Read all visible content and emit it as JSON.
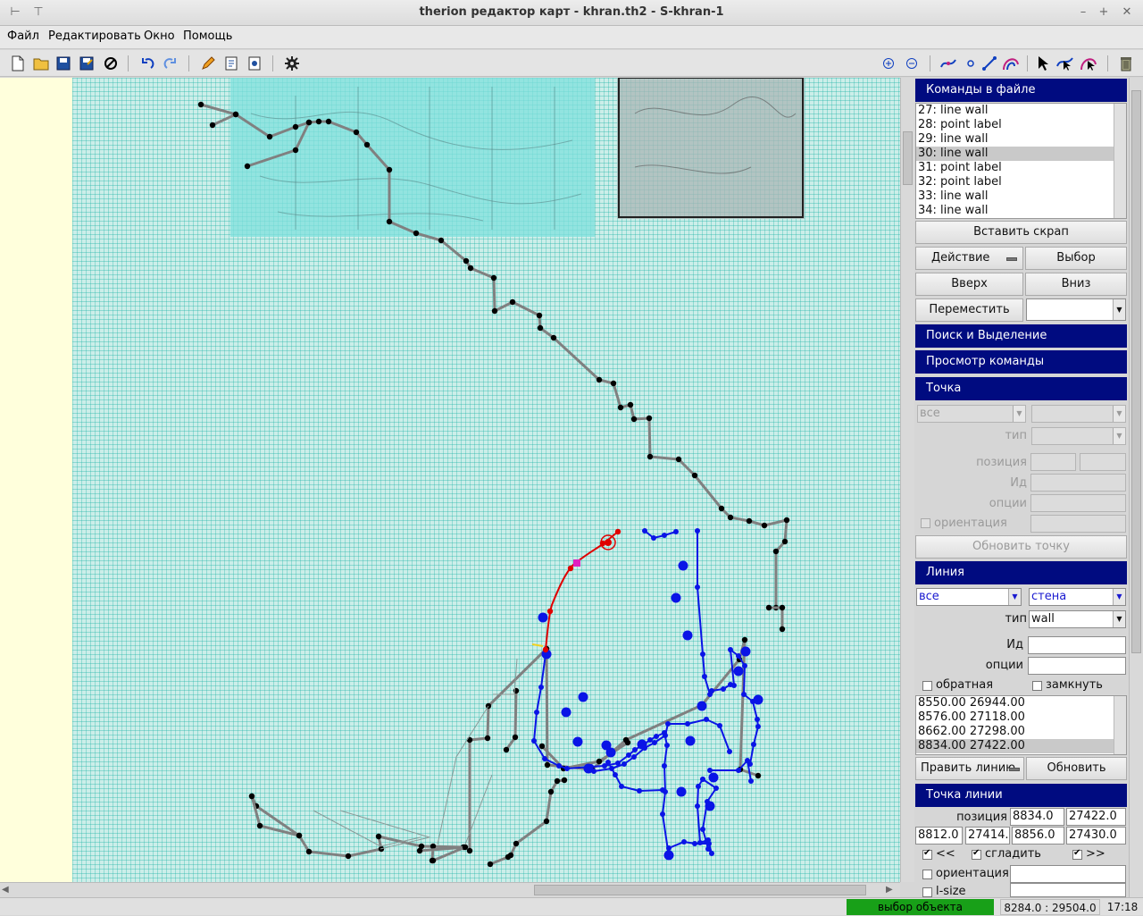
{
  "window": {
    "title": "therion редактор карт - khran.th2 - S-khran-1"
  },
  "menu": {
    "file": "Файл",
    "edit": "Редактировать",
    "window": "Окно",
    "help": "Помощь"
  },
  "toolbar": {
    "left_icons": [
      "new-file-icon",
      "open-folder-icon",
      "save-icon",
      "save-as-icon",
      "close-icon",
      "undo-icon",
      "redo-icon",
      "edit-pencil-icon",
      "page-properties-icon",
      "settings-gear-icon",
      "compile-gear-icon"
    ],
    "right_icons": [
      "zoom-in-icon",
      "zoom-out-icon",
      "insert-line-icon",
      "insert-point-icon",
      "insert-segment-icon",
      "insert-area-icon",
      "select-pointer-icon",
      "select-line-icon",
      "edit-area-icon",
      "trash-icon"
    ]
  },
  "panel": {
    "commands_header": "Команды в файле",
    "commands": [
      "27: line wall",
      "28: point label",
      "29: line wall",
      "30: line wall",
      "31: point label",
      "32: point label",
      "33: line wall",
      "34: line wall"
    ],
    "commands_selected": 3,
    "insert_scrap_button": "Вставить скрап",
    "action_button": "Действие",
    "select_button": "Выбор",
    "up_button": "Вверх",
    "down_button": "Вниз",
    "move_button": "Переместить",
    "move_target": "",
    "search_header": "Поиск и Выделение",
    "view_cmd_header": "Просмотр команды",
    "point_header": "Точка",
    "point_filter": "все",
    "point_filter2": "",
    "point_type_label": "тип",
    "point_type": "",
    "point_position_label": "позиция",
    "point_position_x": "",
    "point_position_y": "",
    "point_id_label": "Ид",
    "point_id": "",
    "point_options_label": "опции",
    "point_options": "",
    "point_orient_label": "ориентация",
    "point_orient": "",
    "update_point_button": "Обновить точку",
    "line_header": "Линия",
    "line_filter": "все",
    "line_class": "стена",
    "line_type_label": "тип",
    "line_type": "wall",
    "line_id_label": "Ид",
    "line_id": "",
    "line_options_label": "опции",
    "line_options": "",
    "reverse_label": "обратная",
    "reverse_checked": false,
    "closed_label": "замкнуть",
    "closed_checked": false,
    "line_points": [
      "8550.00 26944.00",
      "8576.00 27118.00",
      "8662.00 27298.00",
      "8834.00 27422.00"
    ],
    "line_points_selected": 3,
    "edit_line_button": "Править линию",
    "update_button": "Обновить",
    "line_point_header": "Точка линии",
    "lp_position_label": "позиция",
    "lp_x": "8834.0",
    "lp_y": "27422.0",
    "lp_cp1_x": "8812.0",
    "lp_cp1_y": "27414.0",
    "lp_cp2_x": "8856.0",
    "lp_cp2_y": "27430.0",
    "lp_prev_label": "<<",
    "lp_prev_checked": true,
    "lp_smooth_label": "сгладить",
    "lp_smooth_checked": true,
    "lp_next_label": ">>",
    "lp_next_checked": true,
    "lp_orient_label": "ориентация",
    "lp_orient_checked": false,
    "lp_orient": "",
    "lp_lsize_label": "l-size",
    "lp_lsize_checked": false,
    "lp_lsize": ""
  },
  "status": {
    "mode": "выбор объекта",
    "coords": "8284.0 : 29504.0",
    "time": "17:18"
  },
  "colors": {
    "header_bg": "#000b80",
    "grid": "#1fb3a8",
    "canvas_bg": "#cceee9",
    "sketch": "#7fe0dc",
    "mode_green": "#18a018",
    "wall_gray": "#808080",
    "selected_red": "#e00000",
    "blue_line": "#0a14e6"
  }
}
